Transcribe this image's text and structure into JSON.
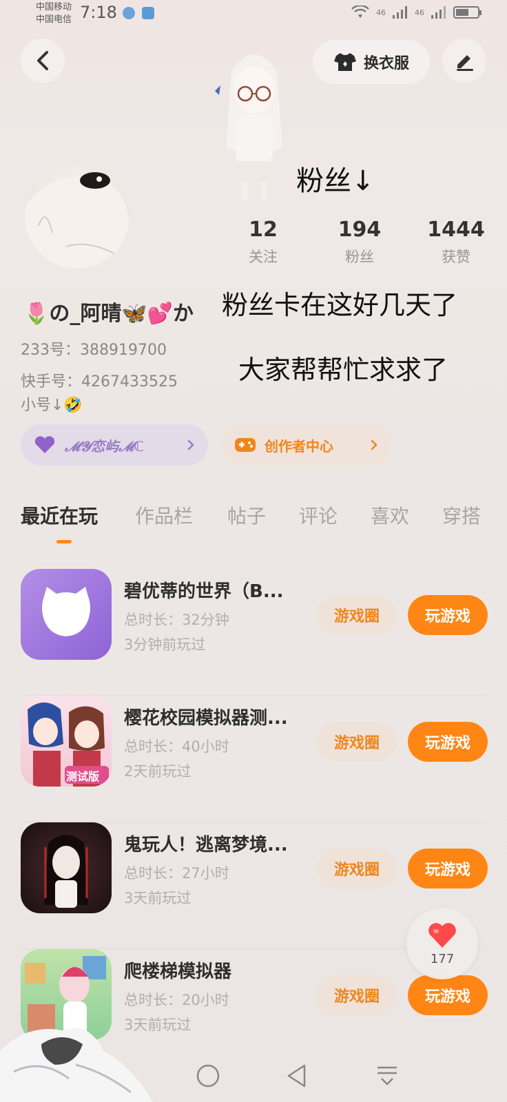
{
  "status_bar": {
    "carrier_1": "中国移动",
    "carrier_2": "中国电信",
    "time": "7:18",
    "network_1": "46",
    "network_2": "46",
    "battery_level": 0.6
  },
  "header": {
    "outfit_label": "换衣服"
  },
  "overlay": {
    "line_1": "粉丝↓",
    "line_2": "粉丝卡在这好几天了",
    "line_3": "大家帮帮忙求求了"
  },
  "stats": [
    {
      "value": "12",
      "label": "关注"
    },
    {
      "value": "194",
      "label": "粉丝"
    },
    {
      "value": "1444",
      "label": "获赞"
    }
  ],
  "profile": {
    "nickname": "🌷の_阿晴🦋💕か",
    "id_233": "233号：388919700",
    "kuaishou_id": "快手号：4267433525",
    "alt_account": "小号↓🤣"
  },
  "pills": {
    "love_label": "𝓜𝓨恋屿𝓜ℂ",
    "creator_label": "创作者中心"
  },
  "tabs": [
    {
      "label": "最近在玩",
      "active": true
    },
    {
      "label": "作品栏",
      "active": false
    },
    {
      "label": "帖子",
      "active": false
    },
    {
      "label": "评论",
      "active": false
    },
    {
      "label": "喜欢",
      "active": false
    },
    {
      "label": "穿搭",
      "active": false
    }
  ],
  "games": [
    {
      "title": "碧优蒂的世界（B...",
      "duration": "总时长：32分钟",
      "last_played": "3分钟前玩过",
      "circle_label": "游戏圈",
      "play_label": "玩游戏"
    },
    {
      "title": "樱花校园模拟器测...",
      "duration": "总时长：40小时",
      "last_played": "2天前玩过",
      "circle_label": "游戏圈",
      "play_label": "玩游戏"
    },
    {
      "title": "鬼玩人！逃离梦境...",
      "duration": "总时长：27小时",
      "last_played": "3天前玩过",
      "circle_label": "游戏圈",
      "play_label": "玩游戏"
    },
    {
      "title": "爬楼梯模拟器",
      "duration": "总时长：20小时",
      "last_played": "3天前玩过",
      "circle_label": "游戏圈",
      "play_label": "玩游戏"
    }
  ],
  "icon_badge": "测试版",
  "like_float": {
    "count": "177"
  },
  "colors": {
    "accent": "#ff8614",
    "accent_soft": "#efe2d9",
    "purple": "#9a7cc3"
  }
}
